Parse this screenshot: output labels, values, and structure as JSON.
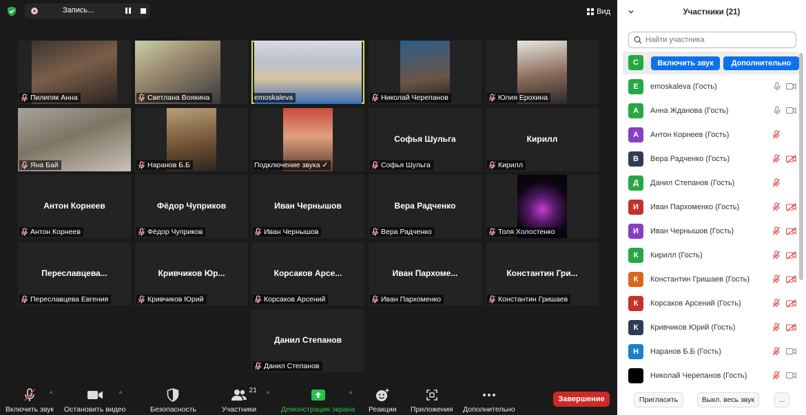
{
  "topbar": {
    "recording_label": "Запись...",
    "view_label": "Вид"
  },
  "tiles": [
    {
      "name": "Пилипяк Анна",
      "video": true
    },
    {
      "name": "Светлана Воякина",
      "video": true
    },
    {
      "name": "emoskaleva",
      "video": true,
      "mic_on": true,
      "active": true
    },
    {
      "name": "Николай Черепанов",
      "video": true
    },
    {
      "name": "Юлия Ерохина",
      "video": true
    },
    {
      "name": "Яна Бай",
      "video": true
    },
    {
      "name": "Наранов Б.Б",
      "video": true
    },
    {
      "name": "Подключение звука ✓",
      "video": true,
      "mic_on": true
    },
    {
      "name": "Софья Шульга",
      "display": "Софья Шульга"
    },
    {
      "name": "Кирилл",
      "display": "Кирилл"
    },
    {
      "name": "Антон Корнеев",
      "display": "Антон Корнеев"
    },
    {
      "name": "Фёдор Чуприков",
      "display": "Фёдор Чуприков"
    },
    {
      "name": "Иван Чернышов",
      "display": "Иван Чернышов"
    },
    {
      "name": "Вера Радченко",
      "display": "Вера Радченко"
    },
    {
      "name": "Толя Холостенко",
      "video": true
    },
    {
      "name": "Переславцева Евгения",
      "display": "Переславцева..."
    },
    {
      "name": "Кривчиков Юрий",
      "display": "Кривчиков Юр..."
    },
    {
      "name": "Корсаков Арсений",
      "display": "Корсаков Арсе..."
    },
    {
      "name": "Иван Пархоменко",
      "display": "Иван Пархоме..."
    },
    {
      "name": "Константин Гришаев",
      "display": "Константин Гри..."
    },
    {
      "name": "Данил Степанов",
      "display": "Данил Степанов"
    }
  ],
  "toolbar": {
    "unmute": "Включить звук",
    "start_video": "Остановить видео",
    "security": "Безопасность",
    "participants": "Участники",
    "participants_count": "21",
    "share": "Демонстрация экрана",
    "reactions": "Реакции",
    "apps": "Приложения",
    "more": "Дополнительно",
    "end": "Завершение"
  },
  "panel": {
    "title": "Участники (21)",
    "search_placeholder": "Найти участника",
    "first_row_btn_unmute": "Включить звук",
    "first_row_btn_more": "Дополнительно",
    "participants": [
      {
        "initial": "С",
        "color": "#27a844",
        "name": ""
      },
      {
        "initial": "E",
        "color": "#27a844",
        "name": "emoskaleva (Гость)",
        "mic": "on",
        "cam": "on"
      },
      {
        "initial": "А",
        "color": "#27a844",
        "name": "Анна Жданова  (Гость)",
        "mic": "on",
        "cam": "on"
      },
      {
        "initial": "А",
        "color": "#8a3fbf",
        "name": "Антон Корнеев (Гость)",
        "mic": "off",
        "cam": "none"
      },
      {
        "initial": "В",
        "color": "#2e3d55",
        "name": "Вера Радченко (Гость)",
        "mic": "off",
        "cam": "off"
      },
      {
        "initial": "Д",
        "color": "#27a844",
        "name": "Данил Степанов (Гость)",
        "mic": "off",
        "cam": "none"
      },
      {
        "initial": "И",
        "color": "#c4322b",
        "name": "Иван Пархоменко (Гость)",
        "mic": "off",
        "cam": "off"
      },
      {
        "initial": "И",
        "color": "#8a3fbf",
        "name": "Иван Чернышов (Гость)",
        "mic": "off",
        "cam": "off"
      },
      {
        "initial": "К",
        "color": "#27a844",
        "name": "Кирилл (Гость)",
        "mic": "off",
        "cam": "off"
      },
      {
        "initial": "К",
        "color": "#d9661c",
        "name": "Константин Гришаев (Гость)",
        "mic": "off",
        "cam": "off"
      },
      {
        "initial": "К",
        "color": "#c4322b",
        "name": "Корсаков Арсений (Гость)",
        "mic": "off",
        "cam": "off"
      },
      {
        "initial": "К",
        "color": "#2e3d55",
        "name": "Кривчиков Юрий (Гость)",
        "mic": "off",
        "cam": "off"
      },
      {
        "initial": "Н",
        "color": "#1a80c8",
        "name": "Наранов Б.Б (Гость)",
        "mic": "off",
        "cam": "on"
      },
      {
        "initial": "",
        "color": "#000000",
        "name": "Николай Черепанов (Гость)",
        "mic": "off",
        "cam": "on"
      }
    ],
    "footer": {
      "invite": "Пригласить",
      "mute_all": "Выкл. весь звук",
      "more": "..."
    }
  }
}
